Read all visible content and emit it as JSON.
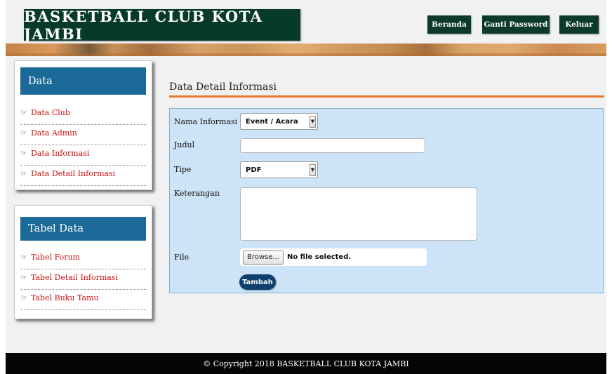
{
  "header": {
    "site_title": "BASKETBALL CLUB KOTA JAMBI",
    "nav": [
      {
        "label": "Beranda"
      },
      {
        "label": "Ganti Password"
      },
      {
        "label": "Keluar"
      }
    ]
  },
  "sidebar": {
    "data_box": {
      "title": "Data",
      "items": [
        {
          "label": "Data Club"
        },
        {
          "label": "Data Admin"
        },
        {
          "label": "Data Informasi"
        },
        {
          "label": "Data Detail Informasi"
        }
      ]
    },
    "table_box": {
      "title": "Tabel Data",
      "items": [
        {
          "label": "Tabel Forum"
        },
        {
          "label": "Tabel Detail Informasi"
        },
        {
          "label": "Tabel Buku Tamu"
        }
      ]
    },
    "item_icon": "hand-pointing-icon"
  },
  "main": {
    "title": "Data Detail Informasi",
    "form": {
      "nama_informasi": {
        "label": "Nama Informasi",
        "value": "Event / Acara"
      },
      "judul": {
        "label": "Judul",
        "value": ""
      },
      "tipe": {
        "label": "Tipe",
        "value": "PDF"
      },
      "keterangan": {
        "label": "Keterangan",
        "value": ""
      },
      "file": {
        "label": "File",
        "button": "Browse...",
        "status": "No file selected."
      },
      "submit": "Tambah"
    }
  },
  "footer": {
    "text": "© Copyright 2018 BASKETBALL CLUB KOTA JAMBI"
  },
  "colors": {
    "header_dark": "#083a2c",
    "sidebar_title": "#1c6a98",
    "link_red": "#cc1111",
    "accent_orange": "#e47726",
    "form_bg": "#cde3f7",
    "submit_bg": "#0f3f6e",
    "footer_bg": "#050505"
  }
}
